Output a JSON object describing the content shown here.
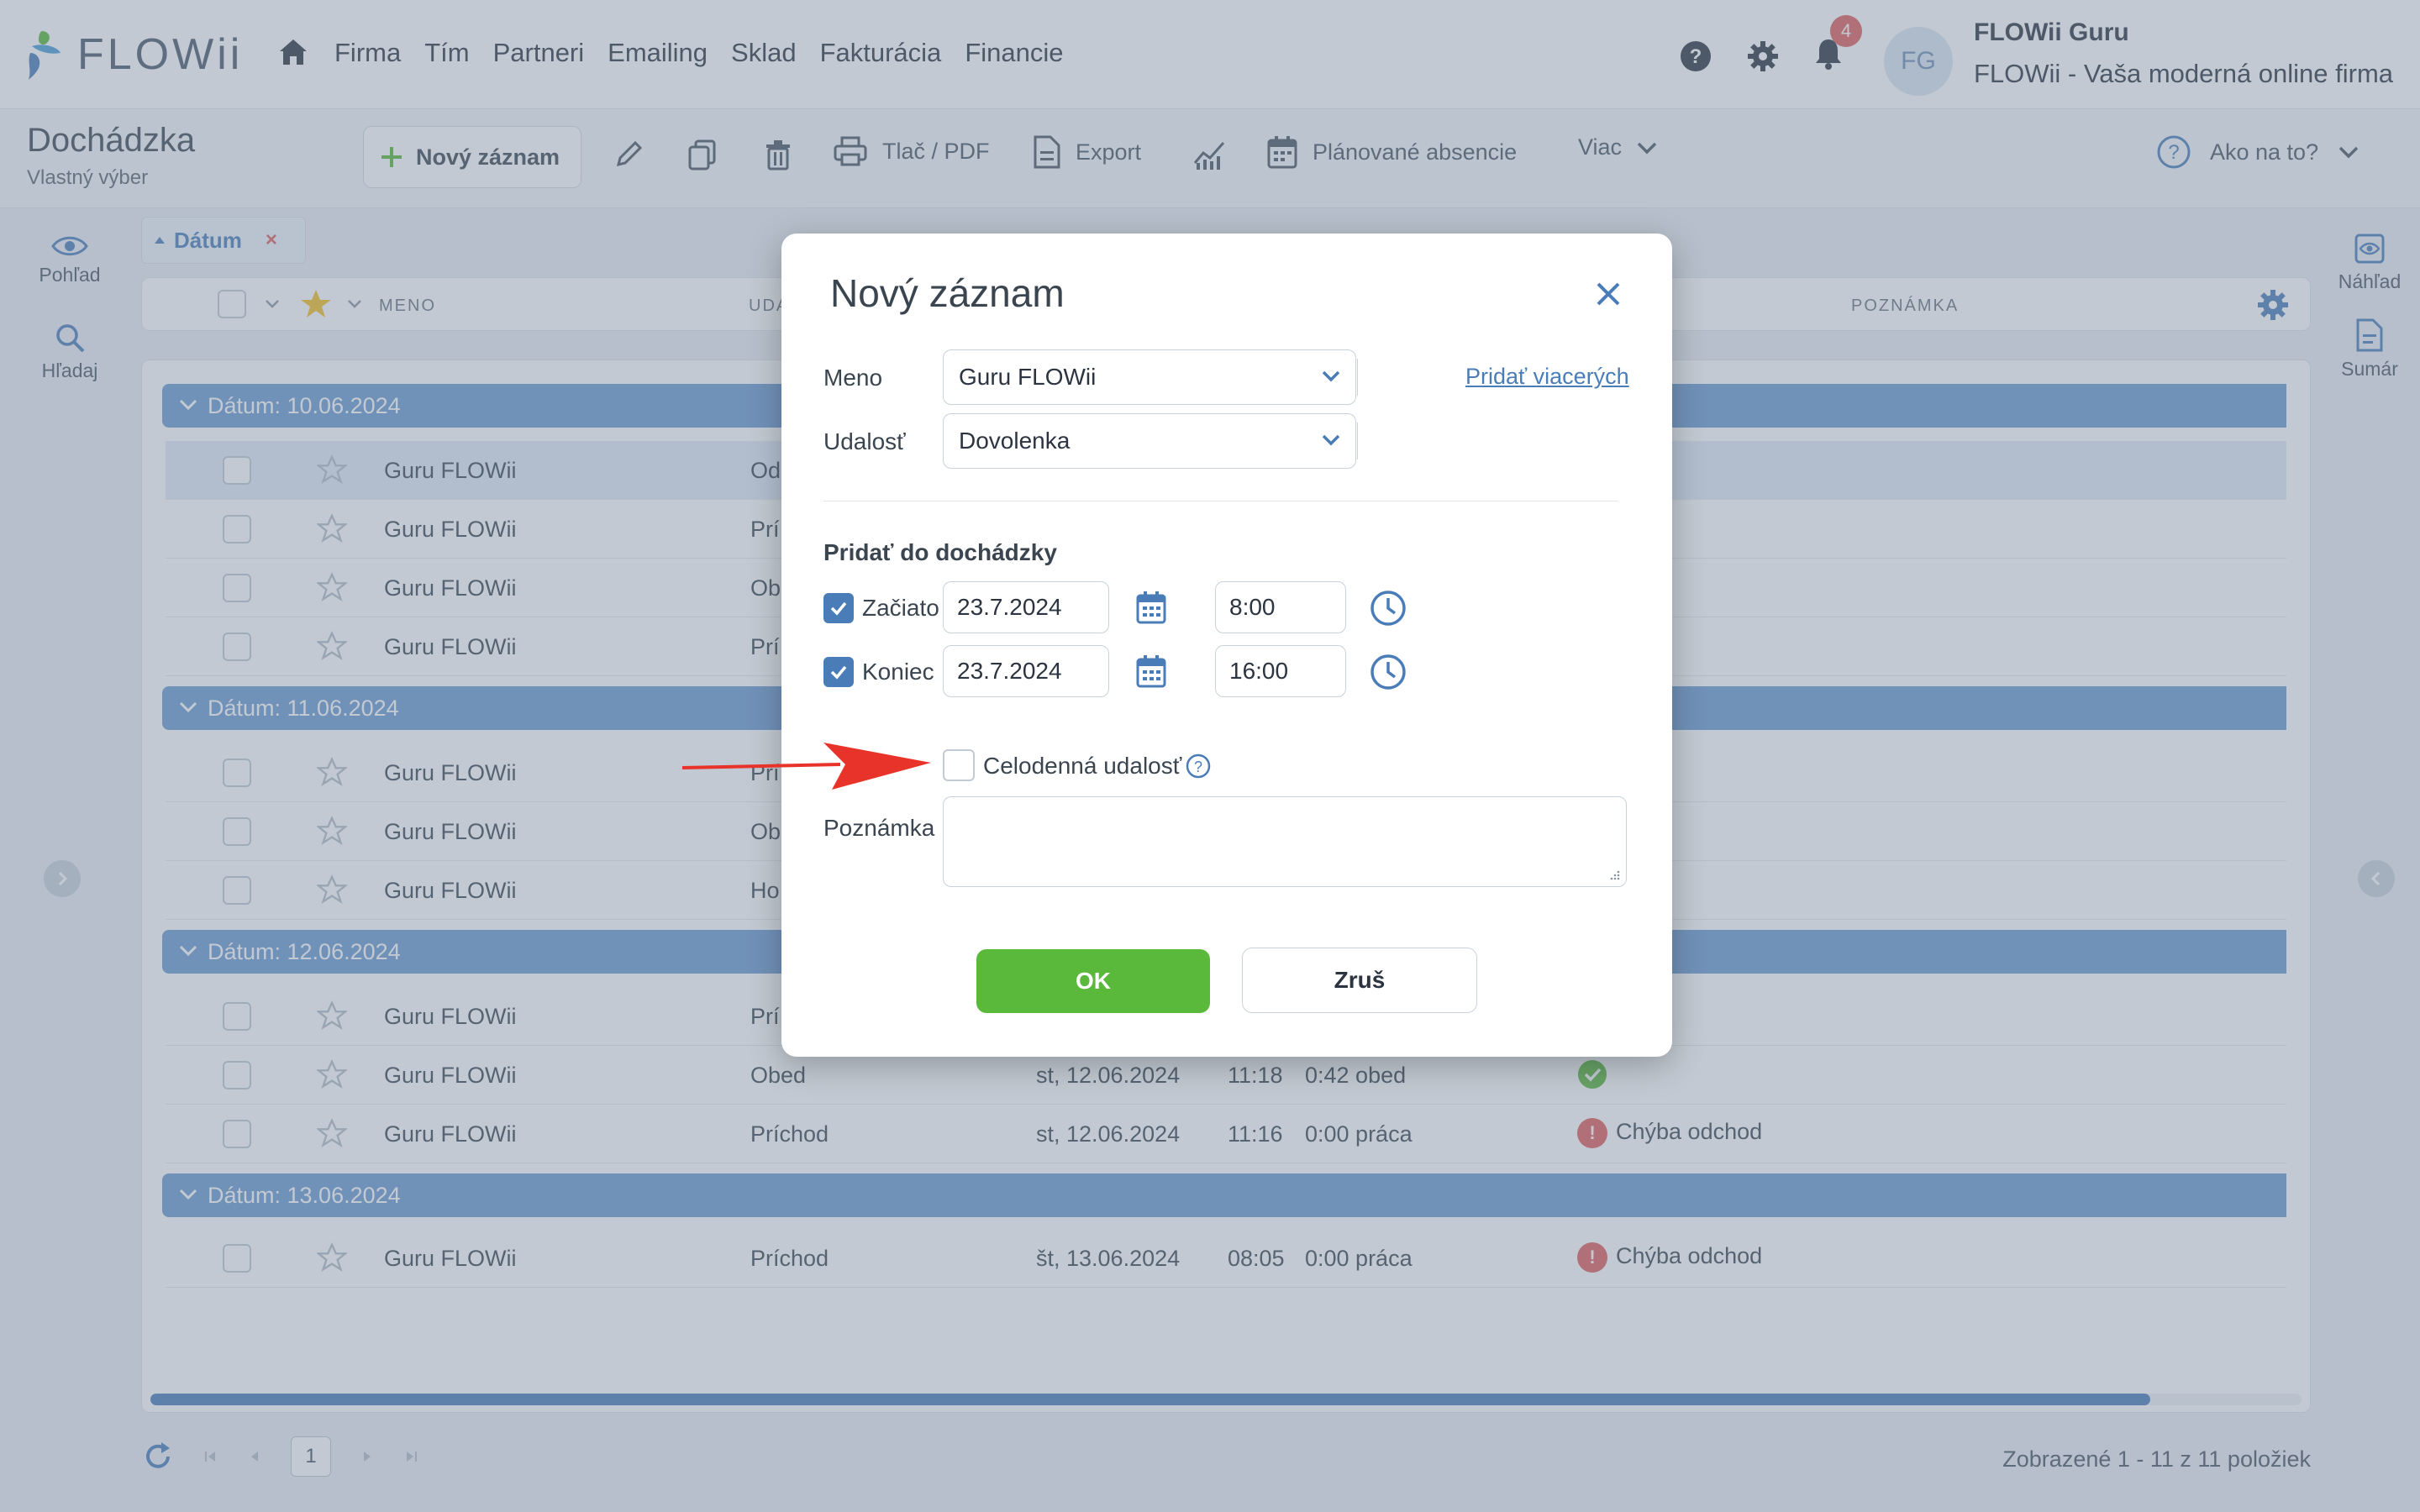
{
  "app": {
    "logo_text": "FLOWii",
    "nav": [
      "Firma",
      "Tím",
      "Partneri",
      "Emailing",
      "Sklad",
      "Fakturácia",
      "Financie"
    ],
    "notifications_count": "4",
    "avatar_initials": "FG",
    "user_name": "FLOWii Guru",
    "user_company": "FLOWii - Vaša moderná online firma"
  },
  "toolbar": {
    "title": "Dochádzka",
    "subtitle": "Vlastný výber",
    "new_record": "Nový záznam",
    "print": "Tlač / PDF",
    "export": "Export",
    "planned": "Plánované absencie",
    "more": "Viac",
    "help": "Ako na to?"
  },
  "sidebar": {
    "view": "Pohľad",
    "search": "Hľadaj",
    "preview": "Náhľad",
    "summary": "Sumár"
  },
  "filter": {
    "label": "Dátum",
    "remove": "×"
  },
  "columns": {
    "name": "MENO",
    "event": "UDA",
    "note": "POZNÁMKA"
  },
  "groups": [
    {
      "label": "Dátum: 10.06.2024",
      "rows": [
        {
          "name": "Guru FLOWii",
          "event": "Od",
          "date": "",
          "time": "",
          "duration": "",
          "status": ""
        },
        {
          "name": "Guru FLOWii",
          "event": "Prí",
          "date": "",
          "time": "",
          "duration": "",
          "status": ""
        },
        {
          "name": "Guru FLOWii",
          "event": "Ob",
          "date": "",
          "time": "",
          "duration": "",
          "status": ""
        },
        {
          "name": "Guru FLOWii",
          "event": "Prí",
          "date": "",
          "time": "",
          "duration": "",
          "status": ""
        }
      ]
    },
    {
      "label": "Dátum: 11.06.2024",
      "rows": [
        {
          "name": "Guru FLOWii",
          "event": "Prí",
          "date": "",
          "time": "",
          "duration": "",
          "status": ""
        },
        {
          "name": "Guru FLOWii",
          "event": "Ob",
          "date": "",
          "time": "",
          "duration": "",
          "status": ""
        },
        {
          "name": "Guru FLOWii",
          "event": "Ho",
          "date": "",
          "time": "",
          "duration": "",
          "status": ""
        }
      ]
    },
    {
      "label": "Dátum: 12.06.2024",
      "rows": [
        {
          "name": "Guru FLOWii",
          "event": "Prí",
          "date": "",
          "time": "",
          "duration": "",
          "status": ""
        },
        {
          "name": "Guru FLOWii",
          "event": "Obed",
          "date": "st, 12.06.2024",
          "time": "11:18",
          "duration": "0:42 obed",
          "status": "ok"
        },
        {
          "name": "Guru FLOWii",
          "event": "Príchod",
          "date": "st, 12.06.2024",
          "time": "11:16",
          "duration": "0:00 práca",
          "status": "Chýba odchod"
        }
      ]
    },
    {
      "label": "Dátum: 13.06.2024",
      "rows": [
        {
          "name": "Guru FLOWii",
          "event": "Príchod",
          "date": "št, 13.06.2024",
          "time": "08:05",
          "duration": "0:00 práca",
          "status": "Chýba odchod"
        }
      ]
    }
  ],
  "footer": {
    "page": "1",
    "info": "Zobrazené 1 - 11 z 11 položiek"
  },
  "modal": {
    "title": "Nový záznam",
    "name_label": "Meno",
    "name_value": "Guru FLOWii",
    "add_multiple": "Pridať viacerých",
    "event_label": "Udalosť",
    "event_value": "Dovolenka",
    "section": "Pridať do dochádzky",
    "start_label": "Začiatok",
    "start_date": "23.7.2024",
    "start_time": "8:00",
    "end_label": "Koniec",
    "end_date": "23.7.2024",
    "end_time": "16:00",
    "all_day_label": "Celodenná udalosť",
    "note_label": "Poznámka",
    "ok": "OK",
    "cancel": "Zruš"
  },
  "colors": {
    "accent": "#4a7db8",
    "group_bar": "#6b9ad0",
    "ok_green": "#5ab83a",
    "error_red": "#e05b5b",
    "arrow_red": "#e8332a"
  }
}
